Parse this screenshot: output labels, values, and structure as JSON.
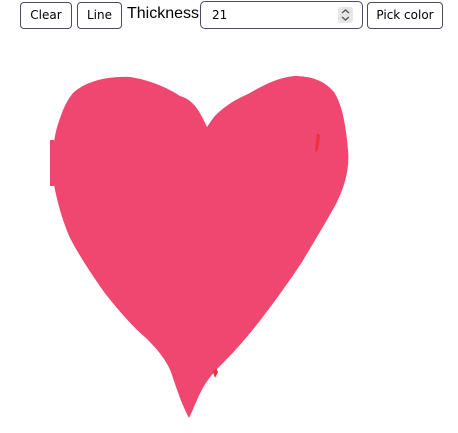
{
  "toolbar": {
    "clear_label": "Clear",
    "line_label": "Line",
    "thickness_label": "Thickness",
    "thickness_value": "21",
    "pick_color_label": "Pick color"
  },
  "canvas": {
    "drawing": "heart",
    "stroke_color": "#ef476f",
    "accent_color": "#e8333a"
  },
  "icons": {
    "stepper": "up-down-stepper-icon"
  }
}
